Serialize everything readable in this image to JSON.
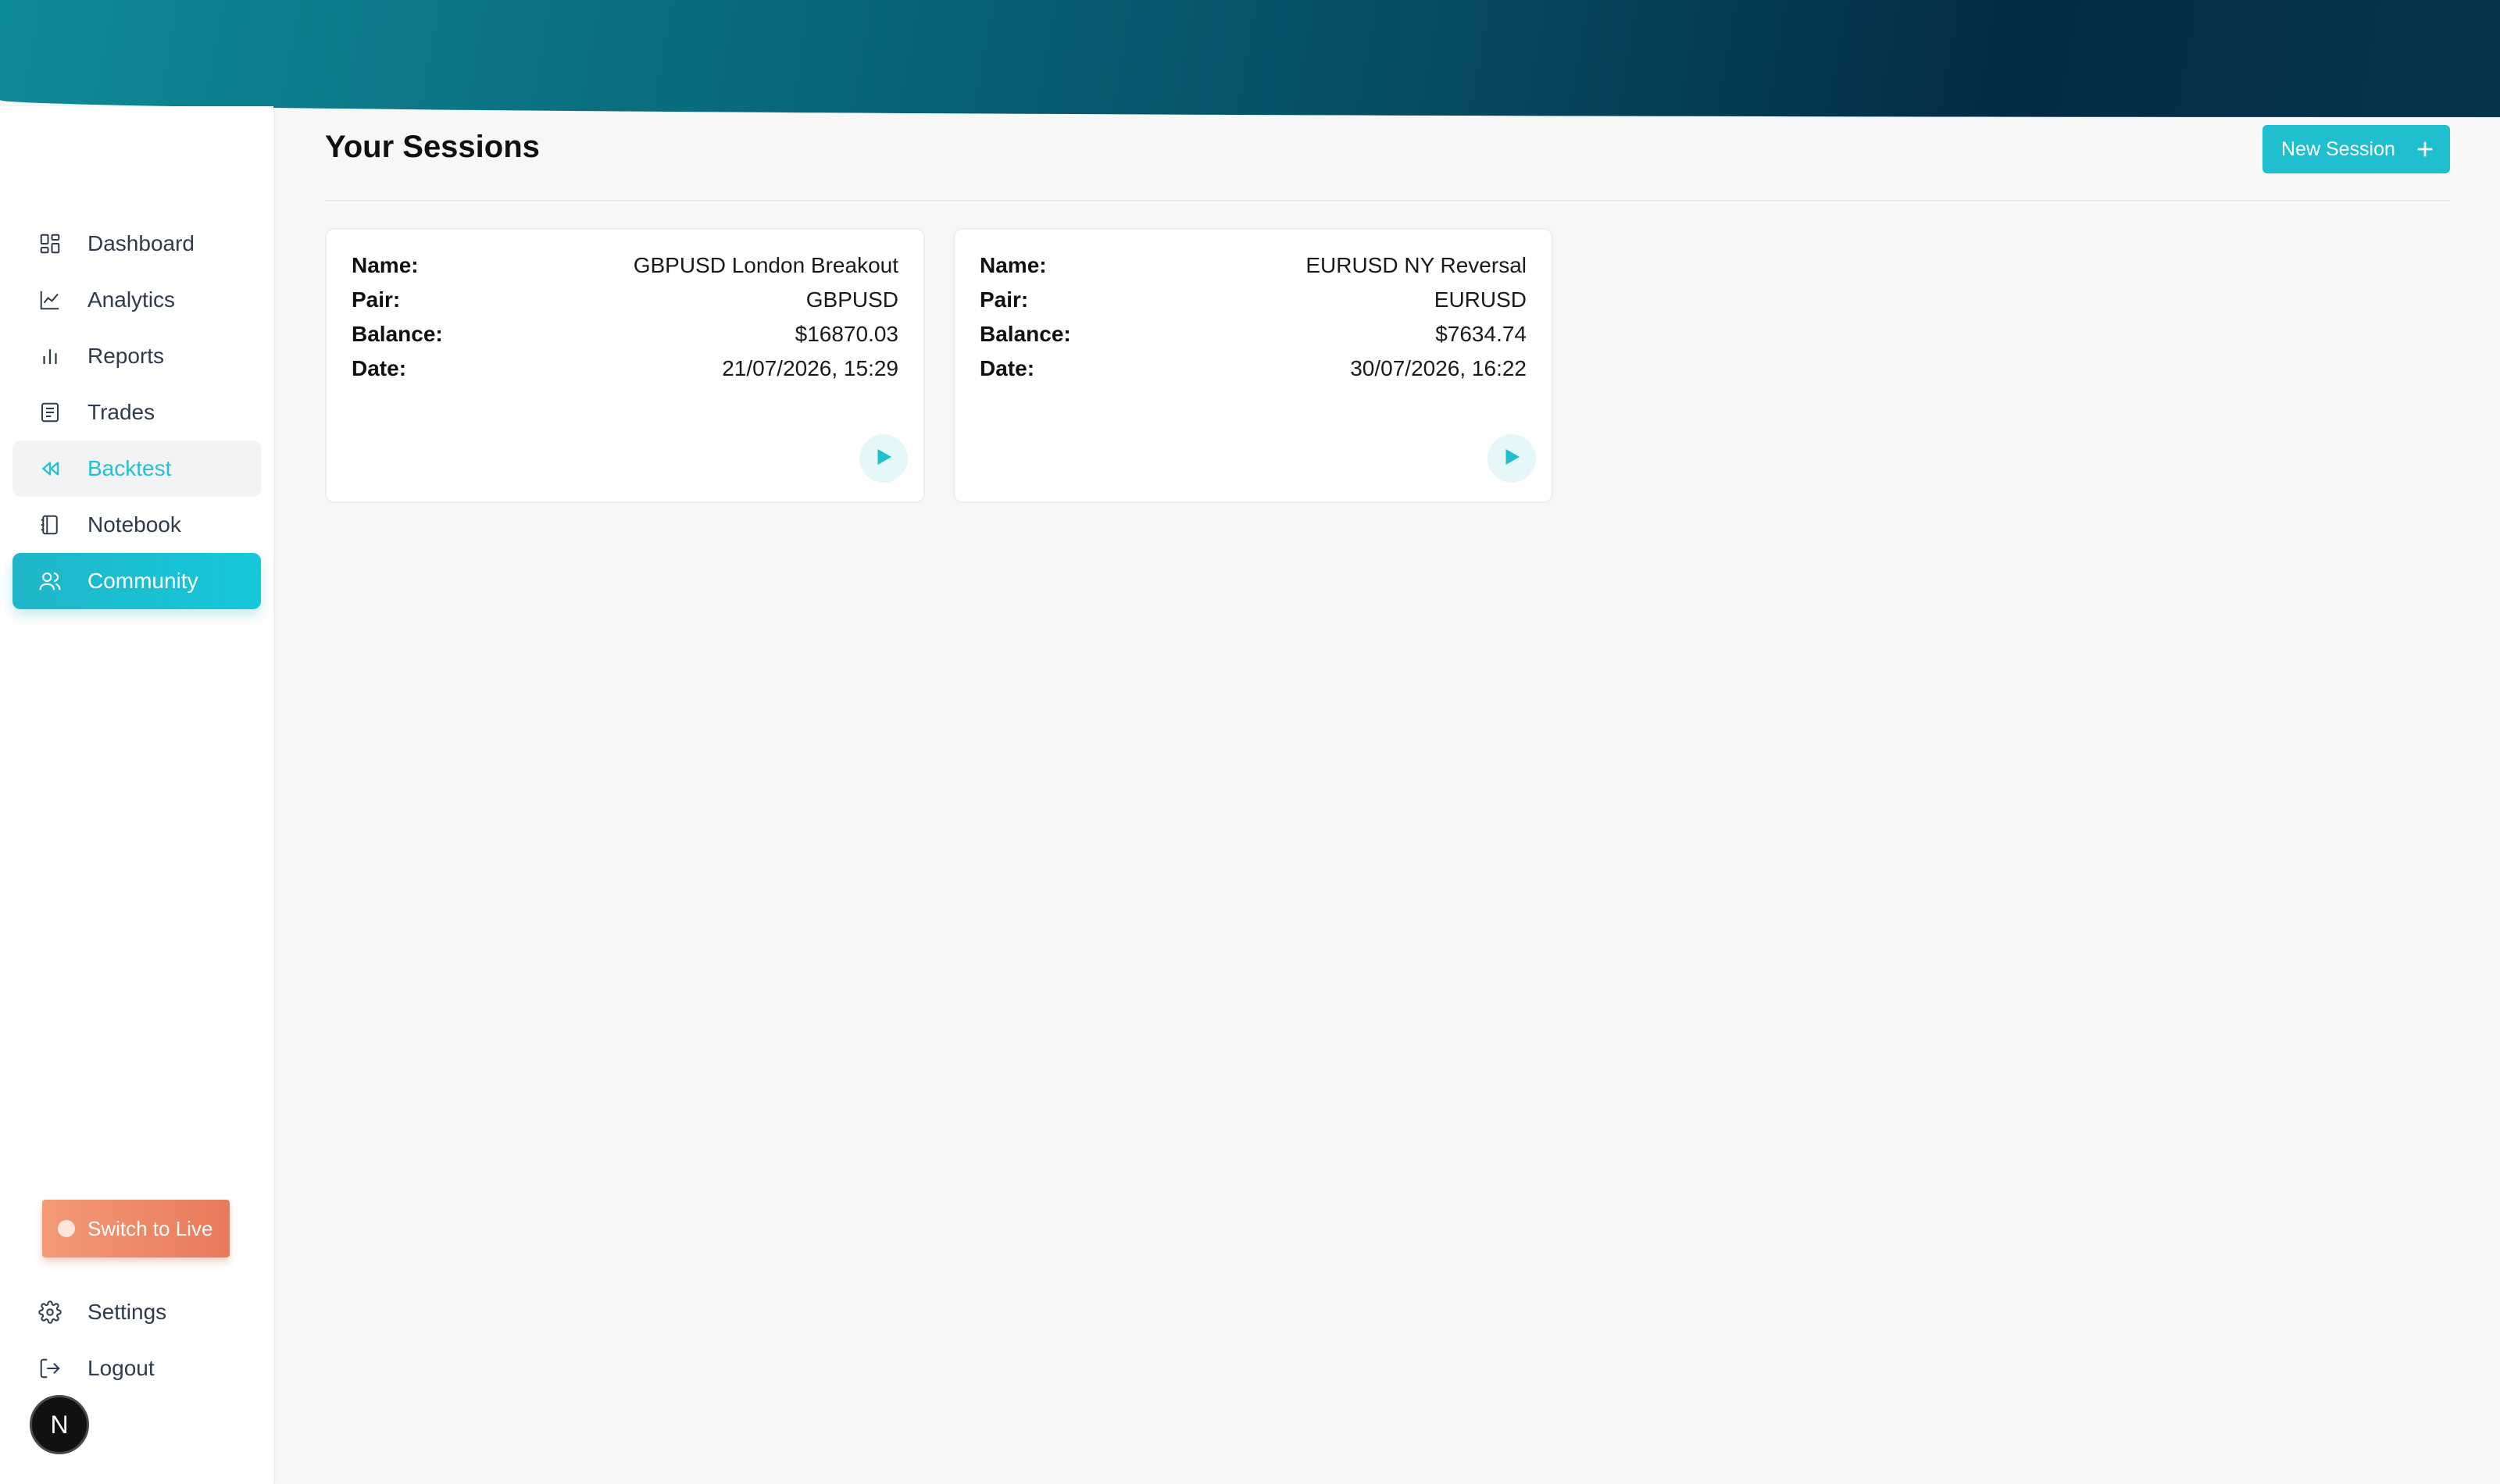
{
  "page": {
    "title": "Your Sessions",
    "new_session_label": "New Session"
  },
  "sidebar": {
    "items": [
      {
        "label": "Dashboard",
        "icon": "dashboard-grid-icon"
      },
      {
        "label": "Analytics",
        "icon": "line-chart-icon"
      },
      {
        "label": "Reports",
        "icon": "bar-chart-icon"
      },
      {
        "label": "Trades",
        "icon": "document-list-icon"
      },
      {
        "label": "Backtest",
        "icon": "rewind-icon",
        "state": "selected"
      },
      {
        "label": "Notebook",
        "icon": "notebook-icon"
      },
      {
        "label": "Community",
        "icon": "users-icon",
        "state": "active"
      }
    ],
    "switch_label": "Switch to Live",
    "bottom_items": [
      {
        "label": "Settings",
        "icon": "gear-icon"
      },
      {
        "label": "Logout",
        "icon": "logout-icon"
      }
    ],
    "avatar_initial": "N"
  },
  "sessions": [
    {
      "name_label": "Name:",
      "name": "GBPUSD London Breakout",
      "pair_label": "Pair:",
      "pair": "GBPUSD",
      "balance_label": "Balance:",
      "balance": "$16870.03",
      "date_label": "Date:",
      "date": "21/07/2026, 15:29"
    },
    {
      "name_label": "Name:",
      "name": "EURUSD NY Reversal",
      "pair_label": "Pair:",
      "pair": "EURUSD",
      "balance_label": "Balance:",
      "balance": "$7634.74",
      "date_label": "Date:",
      "date": "30/07/2026, 16:22"
    }
  ],
  "colors": {
    "accent": "#1fbfd0",
    "switch_live": "#e97a5c",
    "banner_dark": "#032c45"
  }
}
